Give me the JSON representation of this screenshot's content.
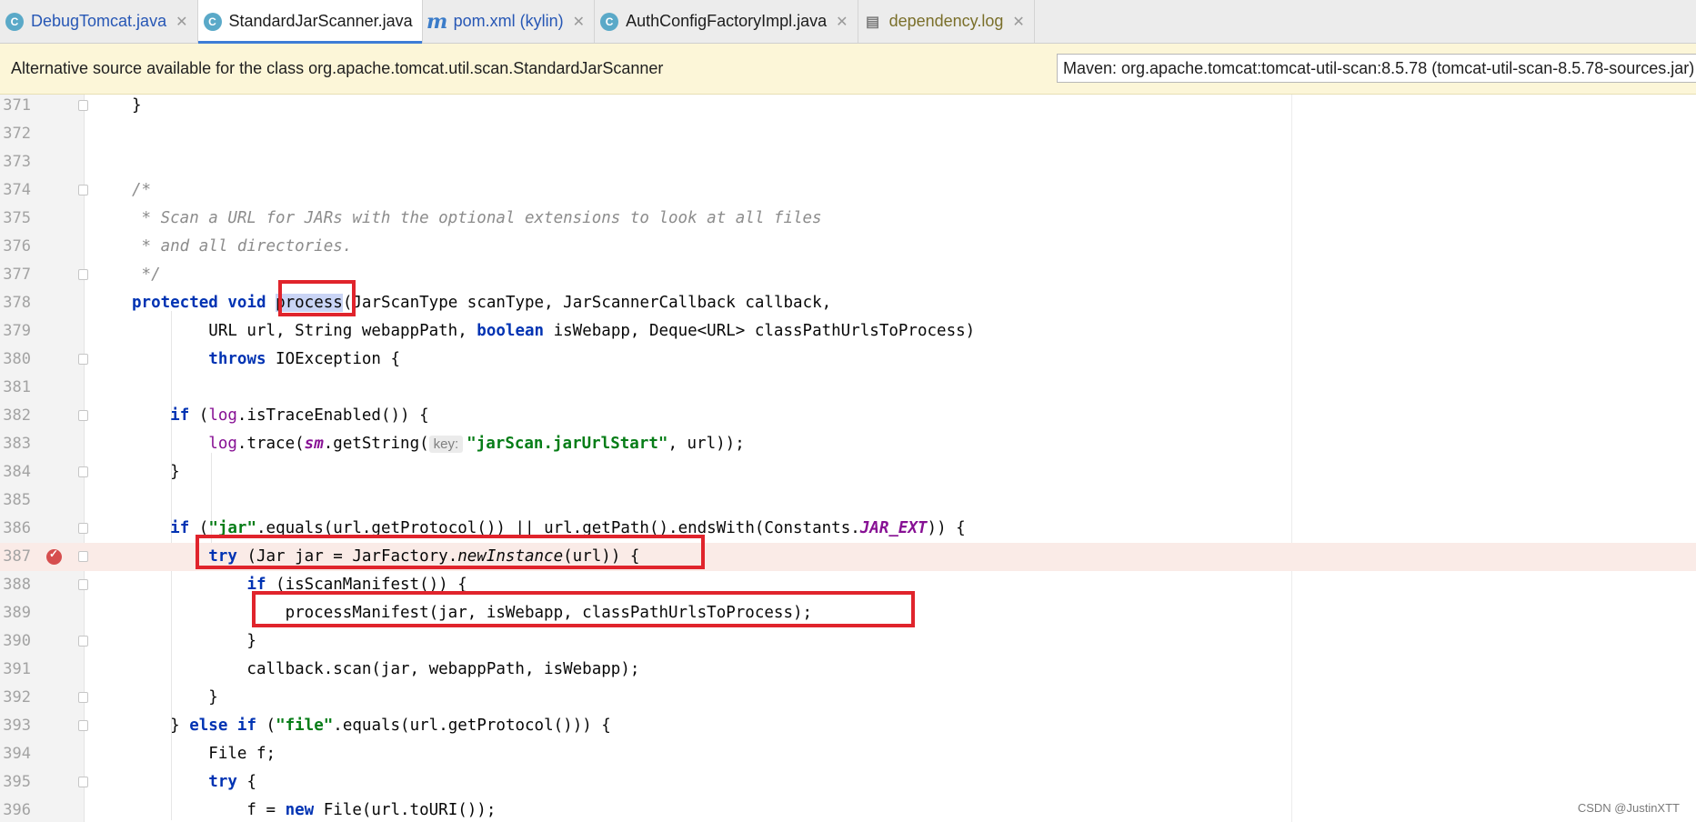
{
  "tabs": [
    {
      "label": "DebugTomcat.java",
      "icon": "c",
      "color": "blue",
      "active": false
    },
    {
      "label": "StandardJarScanner.java",
      "icon": "c",
      "color": "dark",
      "active": true
    },
    {
      "label": "pom.xml (kylin)",
      "icon": "m",
      "color": "blue",
      "active": false
    },
    {
      "label": "AuthConfigFactoryImpl.java",
      "icon": "c",
      "color": "dark",
      "active": false
    },
    {
      "label": "dependency.log",
      "icon": "log",
      "color": "olive",
      "active": false
    }
  ],
  "notice": {
    "text": "Alternative source available for the class org.apache.tomcat.util.scan.StandardJarScanner",
    "selected_source": "Maven: org.apache.tomcat:tomcat-util-scan:8.5.78 (tomcat-util-scan-8.5.78-sources.jar)"
  },
  "editor": {
    "line_numbers": [
      "371",
      "372",
      "373",
      "374",
      "375",
      "376",
      "377",
      "378",
      "379",
      "380",
      "381",
      "382",
      "383",
      "384",
      "385",
      "386",
      "387",
      "388",
      "389",
      "390",
      "391",
      "392",
      "393",
      "394",
      "395",
      "396"
    ],
    "breakpoint_line": "387",
    "param_hint": "key:"
  },
  "colors": {
    "keyword": "#0033b3",
    "string": "#067d17",
    "comment": "#8c8c8c",
    "field": "#871094",
    "annotation_box": "#e0242c",
    "highlight_line": "#faebe7"
  },
  "watermark": "CSDN @JustinXTT"
}
